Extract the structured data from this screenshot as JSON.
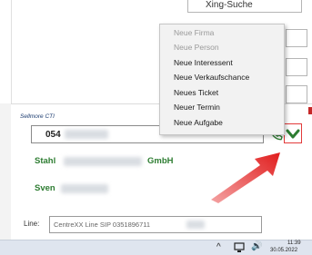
{
  "background": {
    "top_field_label": "Xing-Suche"
  },
  "context_menu": {
    "items": [
      {
        "label": "Neue Firma",
        "enabled": false
      },
      {
        "label": "Neue Person",
        "enabled": false
      },
      {
        "label": "Neue Interessent",
        "enabled": true
      },
      {
        "label": "Neue Verkaufschance",
        "enabled": true
      },
      {
        "label": "Neues Ticket",
        "enabled": true
      },
      {
        "label": "Neuer Termin",
        "enabled": true
      },
      {
        "label": "Neue Aufgabe",
        "enabled": true
      }
    ]
  },
  "popup": {
    "title": "Sellmore CTI",
    "phone_prefix": "054",
    "company_prefix": "Stahl",
    "company_suffix": "GmbH",
    "person_first": "Sven",
    "line_label": "Line:",
    "line_value": "CentreXX Line  SIP 0351896711"
  },
  "colors": {
    "accent_green": "#2e7d32",
    "highlight_red": "#e23a3a"
  },
  "taskbar": {
    "time": "11:39",
    "date": "30.05.2022"
  }
}
